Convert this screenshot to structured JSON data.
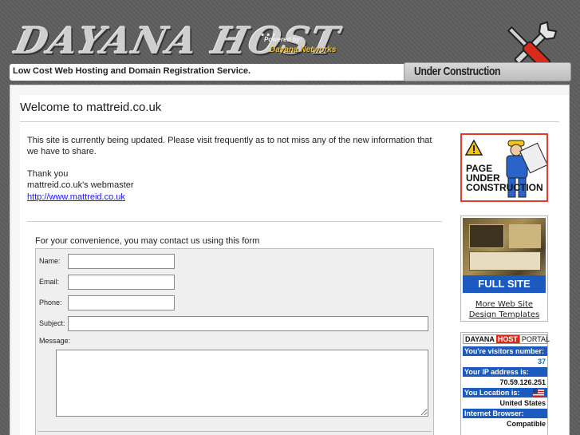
{
  "header": {
    "logo_text": "DAYANA HOST",
    "logo_dots": "...",
    "powered_by": "Powered by:",
    "powered_name": "Dayana Networks",
    "tagline": "Low Cost Web Hosting and Domain Registration Service.",
    "status_badge": "Under Construction"
  },
  "main": {
    "title": "Welcome to mattreid.co.uk",
    "intro": "This site is currently being updated. Please visit frequently as to not miss any of the new information that we have to share.",
    "thanks": "Thank you",
    "webmaster": "mattreid.co.uk's webmaster",
    "site_link": "http://www.mattreid.co.uk"
  },
  "form": {
    "intro": "For your convenience, you may contact us using this form",
    "name_label": "Name:",
    "email_label": "Email:",
    "phone_label": "Phone:",
    "subject_label": "Subject:",
    "message_label": "Message:",
    "name_value": "",
    "email_value": "",
    "phone_value": "",
    "subject_value": "",
    "message_value": ""
  },
  "sidebar": {
    "construction_sign": [
      "PAGE",
      "UNDER",
      "CONSTRUCTION"
    ],
    "full_site_label": "FULL SITE",
    "templates_link": "More Web Site Design Templates",
    "portal": {
      "brand": "DAYANA",
      "host": "HOST",
      "word": "PORTAL",
      "visitors_label": "You're visitors number:",
      "visitors_value": "37",
      "ip_label": "Your IP address is:",
      "ip_value": "70.59.126.251",
      "location_label": "You Location is:",
      "location_value": "United States",
      "browser_label": "Internet Browser:",
      "browser_value": "Compatible"
    }
  },
  "colors": {
    "background": "#5e5e5e",
    "accent_blue": "#1b5bbf",
    "accent_red": "#e53b2c",
    "link": "#1a1aee"
  }
}
